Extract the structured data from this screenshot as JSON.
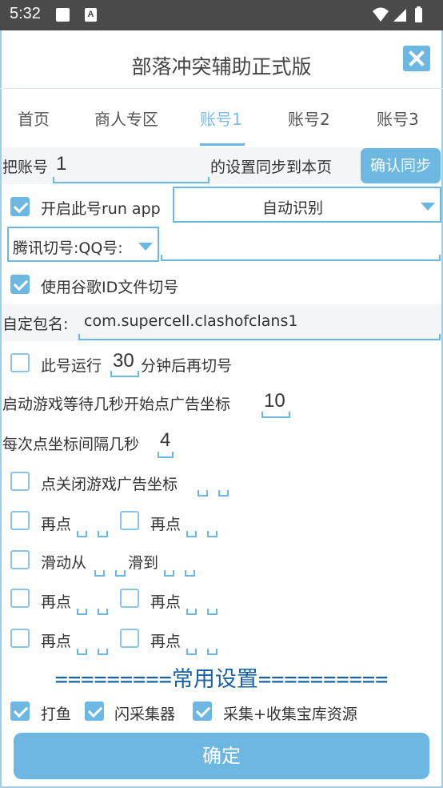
{
  "status_bar": {
    "time": "5:32"
  },
  "app": {
    "title": "部落冲突辅助正式版"
  },
  "tabs": [
    {
      "label": "首页"
    },
    {
      "label": "商人专区"
    },
    {
      "label": "账号1",
      "active": true
    },
    {
      "label": "账号2"
    },
    {
      "label": "账号3"
    }
  ],
  "sync": {
    "prefix": "把账号",
    "value": "1",
    "suffix": "的设置同步到本页",
    "button": "确认同步"
  },
  "run_app": {
    "label": "开启此号run app",
    "checked": true,
    "select_value": "自动识别"
  },
  "tencent": {
    "select_value": "腾讯切号:QQ号:",
    "input_value": ""
  },
  "google": {
    "label": "使用谷歌ID文件切号",
    "checked": true
  },
  "package": {
    "label": "自定包名:",
    "value": "com.supercell.clashofclans1"
  },
  "run_time": {
    "prefix": "此号运行",
    "value": "30",
    "suffix": "分钟后再切号",
    "checked": false
  },
  "ad_wait": {
    "label": "启动游戏等待几秒开始点广告坐标",
    "value": "10"
  },
  "click_interval": {
    "label": "每次点坐标间隔几秒",
    "value": "4"
  },
  "close_ad": {
    "label": "点关闭游戏广告坐标",
    "checked": false
  },
  "click_rows": [
    {
      "left": "再点",
      "right": "再点"
    },
    {
      "left": "滑动从",
      "right": "滑到"
    },
    {
      "left": "再点",
      "right": "再点"
    },
    {
      "left": "再点",
      "right": "再点"
    }
  ],
  "common_heading": "=========常用设置==========",
  "common": [
    {
      "label": "打鱼",
      "checked": true
    },
    {
      "label": "闪采集器",
      "checked": true
    },
    {
      "label": "采集+收集宝库资源",
      "checked": true
    }
  ],
  "confirm_button": "确定",
  "colors": {
    "accent": "#6db7e3",
    "heading": "#1a62a6",
    "status_bar": "#4a4a4a"
  }
}
